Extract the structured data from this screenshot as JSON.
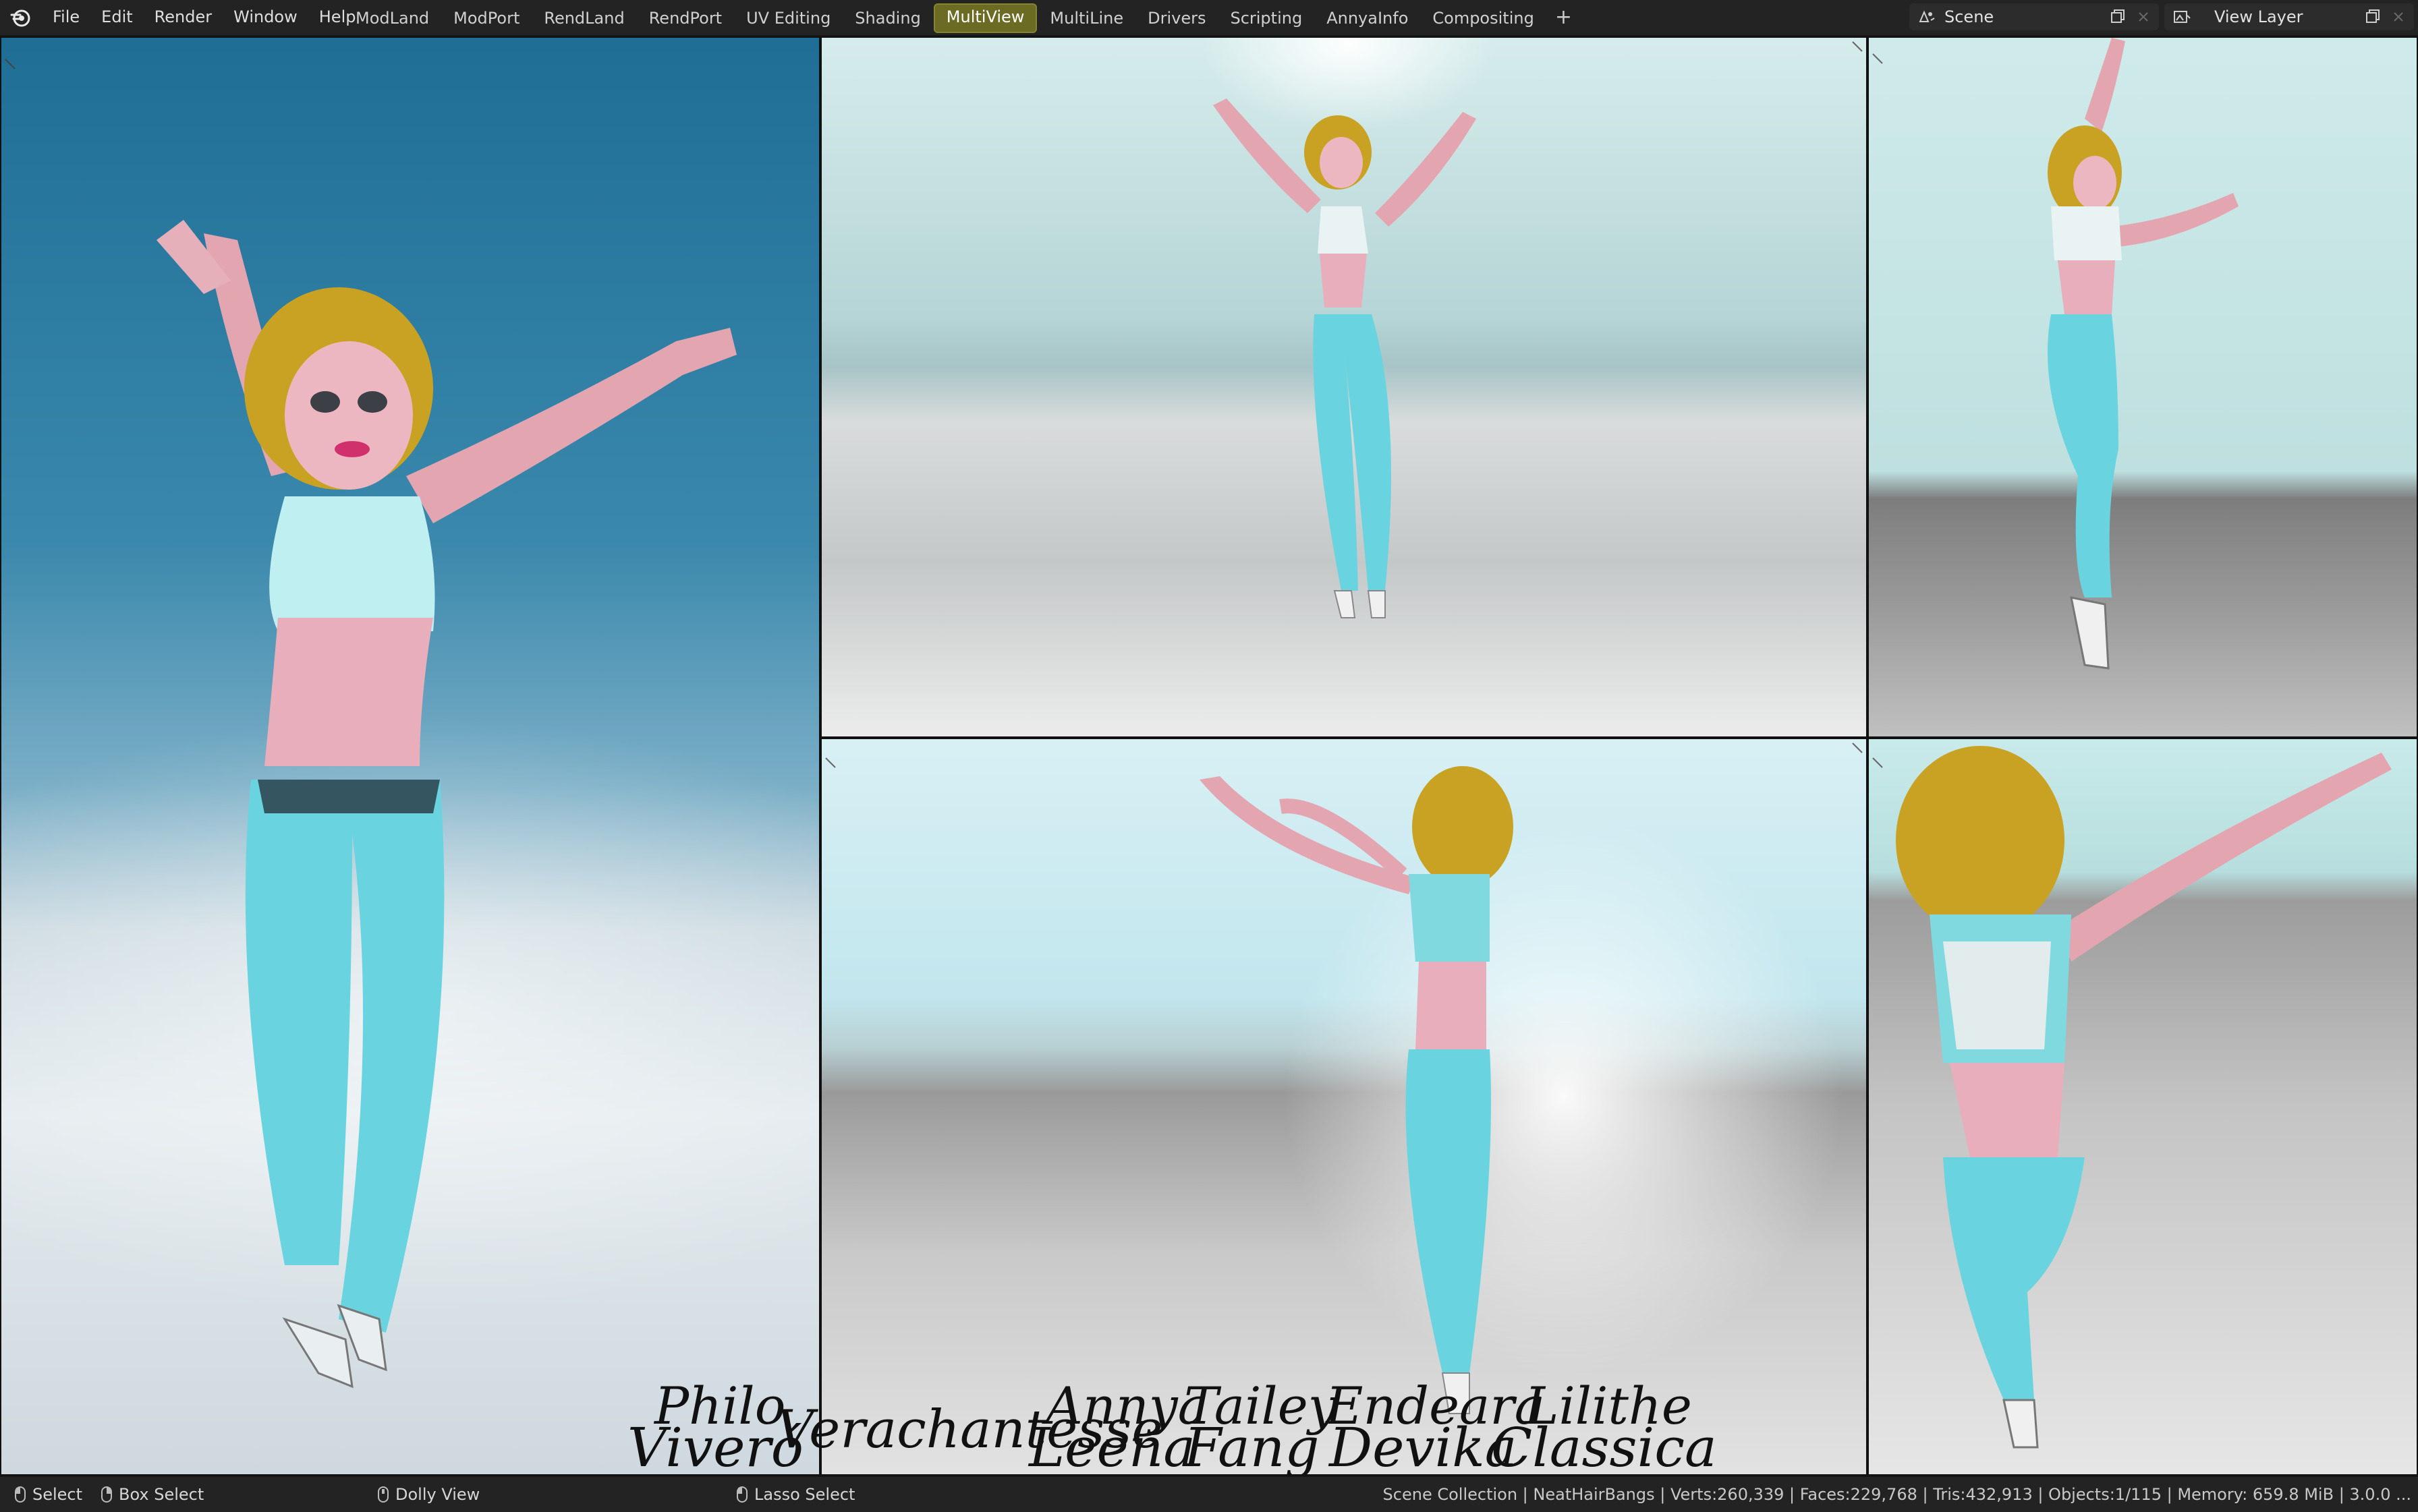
{
  "menu": [
    "File",
    "Edit",
    "Render",
    "Window",
    "Help"
  ],
  "workspace_tabs": [
    {
      "label": "ModLand",
      "active": false
    },
    {
      "label": "ModPort",
      "active": false
    },
    {
      "label": "RendLand",
      "active": false
    },
    {
      "label": "RendPort",
      "active": false
    },
    {
      "label": "UV Editing",
      "active": false
    },
    {
      "label": "Shading",
      "active": false
    },
    {
      "label": "MultiView",
      "active": true
    },
    {
      "label": "MultiLine",
      "active": false
    },
    {
      "label": "Drivers",
      "active": false
    },
    {
      "label": "Scripting",
      "active": false
    },
    {
      "label": "AnnyaInfo",
      "active": false
    },
    {
      "label": "Compositing",
      "active": false
    }
  ],
  "add_tab_label": "+",
  "scene": {
    "label": "Scene"
  },
  "view_layer": {
    "label": "View Layer"
  },
  "signature_names": [
    {
      "top": "Philo",
      "bottom": "Viveró"
    },
    {
      "top": "",
      "bottom": "Verachantesse"
    },
    {
      "top": "Annya",
      "bottom": "Leena"
    },
    {
      "top": "Tailey",
      "bottom": "Fang"
    },
    {
      "top": "Endeara",
      "bottom": "Devika"
    },
    {
      "top": "Lilithe",
      "bottom": "Classica"
    }
  ],
  "status": {
    "select": "Select",
    "box_select": "Box Select",
    "dolly_view": "Dolly View",
    "lasso_select": "Lasso Select",
    "stats": "Scene Collection | NeatHairBangs | Verts:260,339 | Faces:229,768 | Tris:432,913 | Objects:1/115 | Memory: 659.8 MiB | 3.0.0 ..."
  },
  "icons": [
    "blender-logo-icon",
    "scene-icon",
    "view-layer-icon",
    "copy-icon",
    "close-icon",
    "mouse-left-icon",
    "mouse-middle-icon"
  ],
  "colors": {
    "active_tab": "#6b6b24",
    "topbar": "#232323",
    "statusbar": "#232323"
  }
}
